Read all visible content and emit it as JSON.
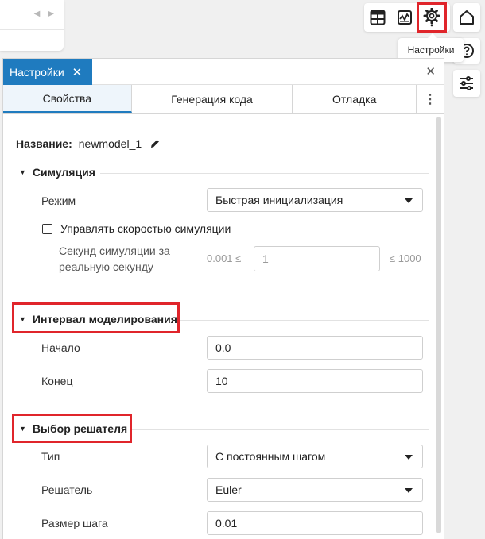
{
  "toolbar": {
    "tooltip": "Настройки",
    "buttons": [
      {
        "icon": "table-icon"
      },
      {
        "icon": "chart-monitor-icon"
      },
      {
        "icon": "gear-icon",
        "highlighted": true
      }
    ],
    "side_buttons": [
      {
        "icon": "home-icon"
      },
      {
        "icon": "help-icon"
      },
      {
        "icon": "sliders-icon"
      }
    ]
  },
  "panel": {
    "tab_label": "Настройки",
    "subtabs": [
      "Свойства",
      "Генерация кода",
      "Отладка"
    ],
    "name_label": "Название:",
    "name_value": "newmodel_1",
    "simulation": {
      "title": "Симуляция",
      "mode_label": "Режим",
      "mode_value": "Быстрая инициализация",
      "speed_checkbox_label": "Управлять скоростью симуляции",
      "speed_checked": false,
      "seconds_label_line1": "Секунд симуляции за",
      "seconds_label_line2": "реальную секунду",
      "min_label": "0.001 ≤",
      "seconds_value": "1",
      "max_label": "≤ 1000"
    },
    "interval": {
      "title": "Интервал моделирования",
      "start_label": "Начало",
      "start_value": "0.0",
      "end_label": "Конец",
      "end_value": "10"
    },
    "solver": {
      "title": "Выбор решателя",
      "type_label": "Тип",
      "type_value": "С постоянным шагом",
      "solver_label": "Решатель",
      "solver_value": "Euler",
      "step_label": "Размер шага",
      "step_value": "0.01"
    }
  },
  "colors": {
    "accent": "#1f7bbf",
    "highlight": "#e0252b"
  }
}
